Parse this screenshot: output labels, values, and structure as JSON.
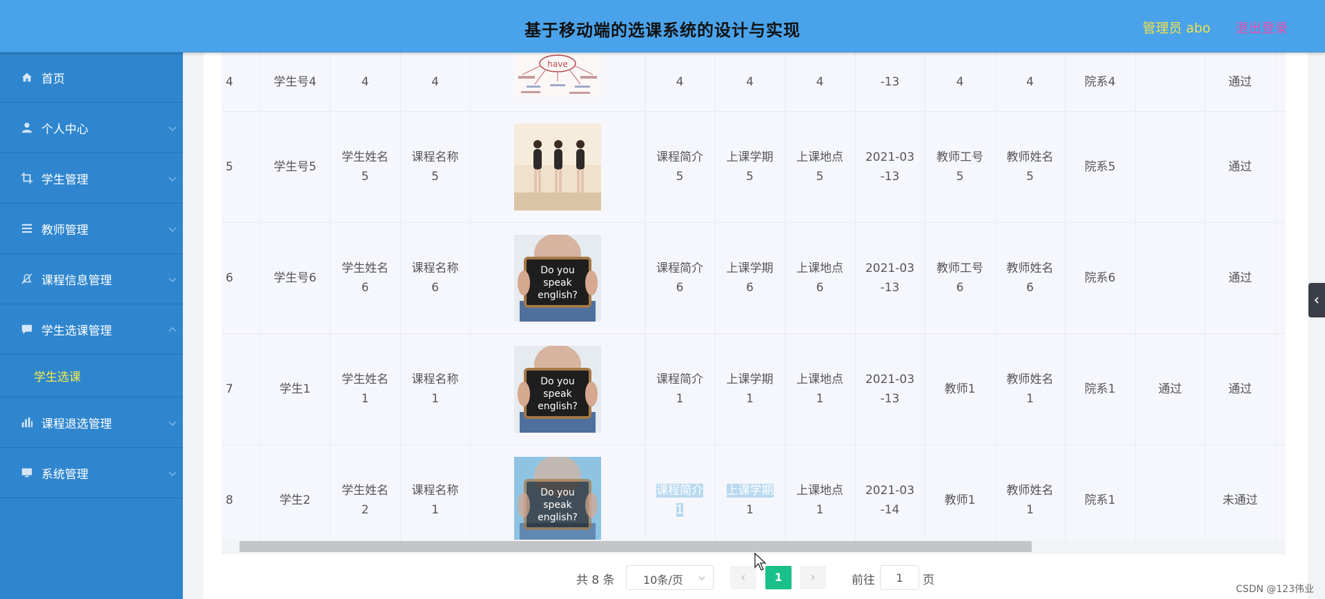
{
  "header": {
    "title": "基于移动端的选课系统的设计与实现",
    "user": "管理员 abo",
    "logout": "退出登录"
  },
  "sidebar": {
    "items": [
      {
        "label": "首页",
        "icon": "home-icon"
      },
      {
        "label": "个人中心",
        "icon": "user-icon"
      },
      {
        "label": "学生管理",
        "icon": "crop-icon"
      },
      {
        "label": "教师管理",
        "icon": "menu-icon"
      },
      {
        "label": "课程信息管理",
        "icon": "bell-off-icon"
      },
      {
        "label": "学生选课管理",
        "icon": "chat-icon"
      },
      {
        "label": "课程退选管理",
        "icon": "bar-chart-icon"
      },
      {
        "label": "系统管理",
        "icon": "monitor-icon"
      }
    ],
    "submenu": {
      "label": "学生选课"
    }
  },
  "table": {
    "rows": [
      {
        "idx": "4",
        "c1": "学生号4",
        "c2": "4",
        "c3": "4",
        "img": "mindmap",
        "c5": "4",
        "c6": "4",
        "c7": "4",
        "c8": "-13",
        "c9": "4",
        "c10": "4",
        "c11": "院系4",
        "c12": "",
        "c13": "通过"
      },
      {
        "idx": "5",
        "c1": "学生号5",
        "c2": "学生姓名\n5",
        "c3": "课程名称\n5",
        "img": "dancers",
        "c5": "课程简介\n5",
        "c6": "上课学期\n5",
        "c7": "上课地点\n5",
        "c8": "2021-03\n-13",
        "c9": "教师工号\n5",
        "c10": "教师姓名\n5",
        "c11": "院系5",
        "c12": "",
        "c13": "通过"
      },
      {
        "idx": "6",
        "c1": "学生号6",
        "c2": "学生姓名\n6",
        "c3": "课程名称\n6",
        "img": "sign",
        "c5": "课程简介\n6",
        "c6": "上课学期\n6",
        "c7": "上课地点\n6",
        "c8": "2021-03\n-13",
        "c9": "教师工号\n6",
        "c10": "教师姓名\n6",
        "c11": "院系6",
        "c12": "",
        "c13": "通过"
      },
      {
        "idx": "7",
        "c1": "学生1",
        "c2": "学生姓名\n1",
        "c3": "课程名称\n1",
        "img": "sign",
        "c5": "课程简介\n1",
        "c6": "上课学期\n1",
        "c7": "上课地点\n1",
        "c8": "2021-03\n-13",
        "c9": "教师1",
        "c10": "教师姓名\n1",
        "c11": "院系1",
        "c12": "通过",
        "c13": "通过"
      },
      {
        "idx": "8",
        "c1": "学生2",
        "c2": "学生姓名\n2",
        "c3": "课程名称\n1",
        "img": "sign-selected",
        "c5": "课程简介\n1",
        "c6": "上课学期\n1",
        "c7": "上课地点\n1",
        "c8": "2021-03\n-14",
        "c9": "教师1",
        "c10": "教师姓名\n1",
        "c11": "院系1",
        "c12": "",
        "c13": "未通过"
      }
    ],
    "sign_text": [
      "Do you",
      "speak",
      "english?"
    ],
    "mindmap_text": "have"
  },
  "pagination": {
    "total": "共 8 条",
    "page_size": "10条/页",
    "current": "1",
    "goto_label": "前往",
    "goto_value": "1",
    "page_suffix": "页"
  },
  "watermark": "CSDN @123伟业",
  "colors": {
    "header_bg": "#4aa3ea",
    "sidebar_bg": "#2f86cf",
    "active_submenu": "#f3ec4a",
    "pager_active": "#19c08a",
    "user_text": "#f3e04a",
    "logout_text": "#e64fb0"
  }
}
